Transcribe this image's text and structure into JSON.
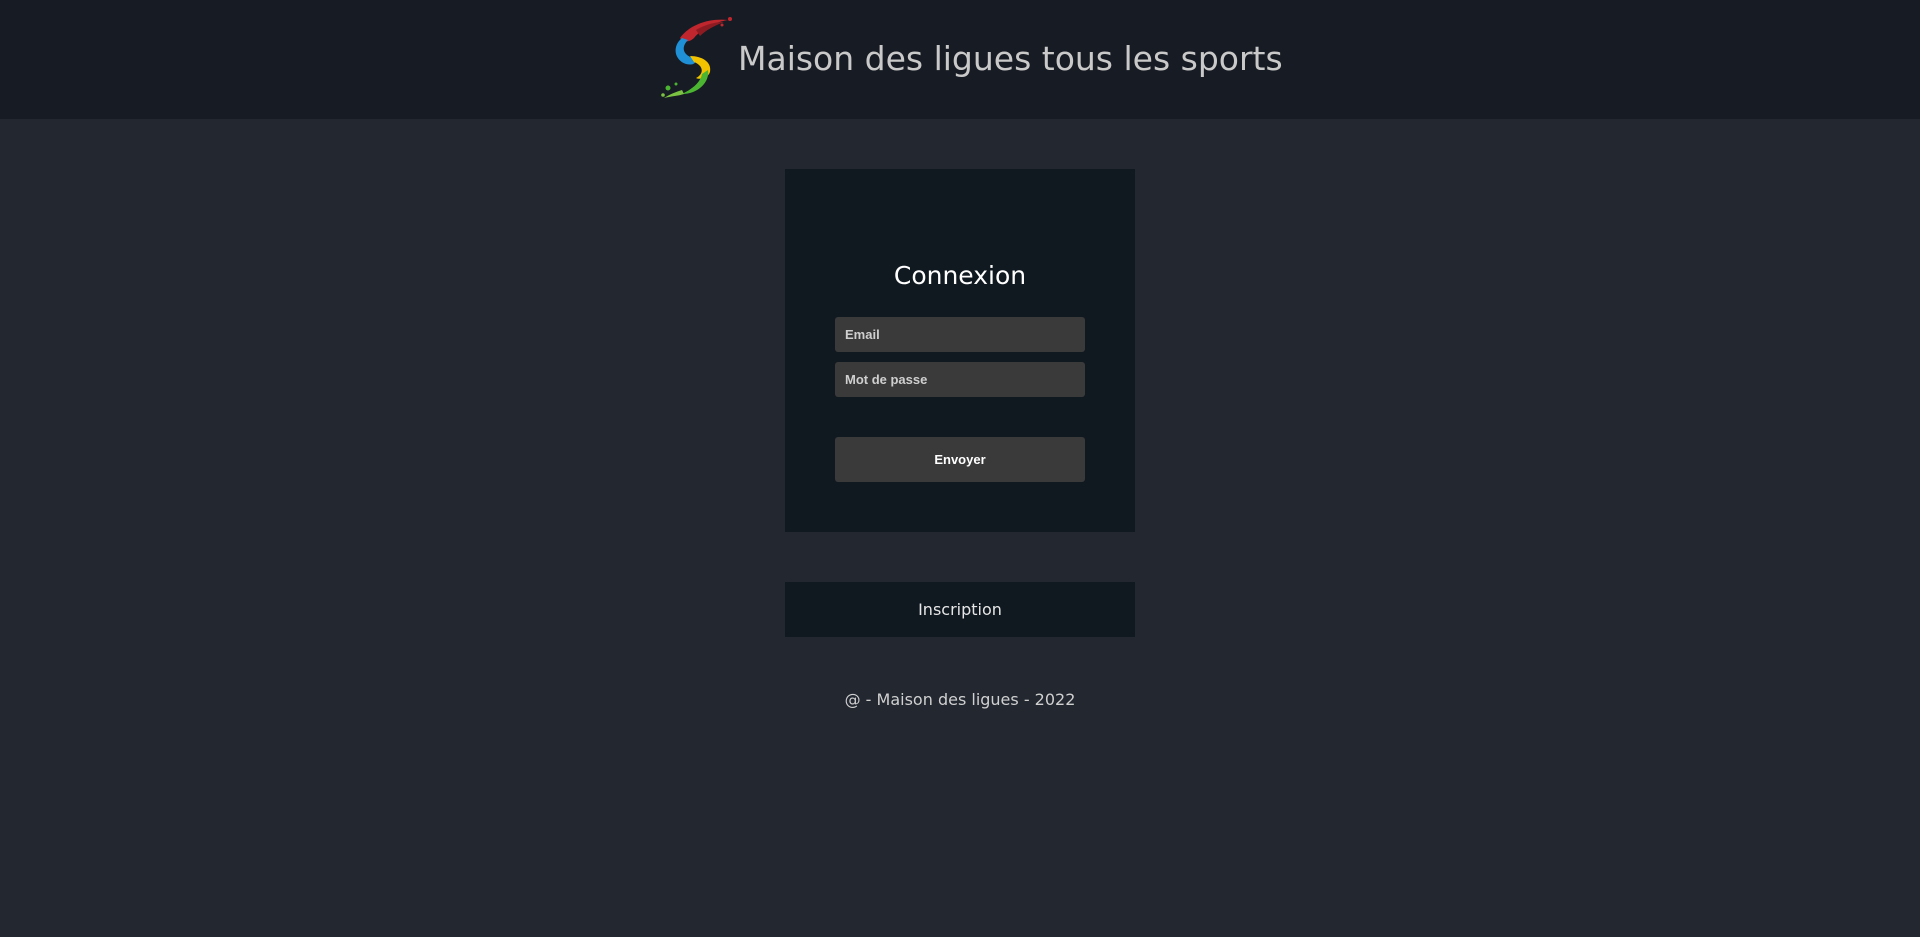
{
  "header": {
    "title": "Maison des ligues tous les sports",
    "logo_icon": "sport-swirl-logo-icon",
    "background": "#171b23"
  },
  "login": {
    "title": "Connexion",
    "email_placeholder": "Email",
    "email_value": "",
    "password_placeholder": "Mot de passe",
    "password_value": "",
    "submit_label": "Envoyer"
  },
  "signup": {
    "label": "Inscription"
  },
  "footer": {
    "text": "@ - Maison des ligues - 2022"
  },
  "colors": {
    "page_background": "#222730",
    "card_background": "#101820",
    "input_background": "#3a3a3a"
  }
}
